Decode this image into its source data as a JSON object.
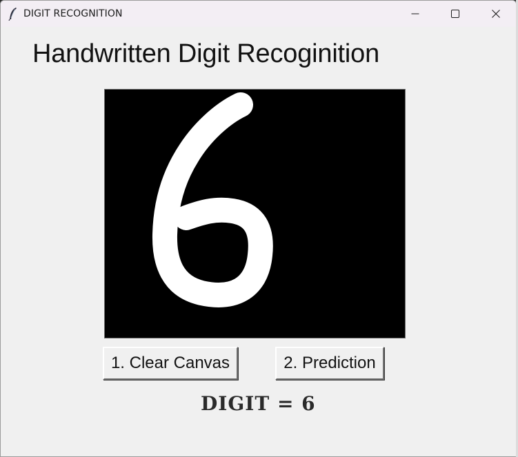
{
  "window": {
    "title": "DIGIT RECOGNITION",
    "app_icon": "feather-icon",
    "controls": {
      "minimize_icon": "minimize-icon",
      "maximize_icon": "maximize-icon",
      "close_icon": "close-icon"
    }
  },
  "main": {
    "heading": "Handwritten Digit Recoginition",
    "canvas": {
      "background": "#000000",
      "stroke_color": "#ffffff"
    },
    "buttons": {
      "clear_label": "1. Clear Canvas",
      "predict_label": "2. Prediction"
    },
    "result_text": "DIGIT = 6"
  }
}
